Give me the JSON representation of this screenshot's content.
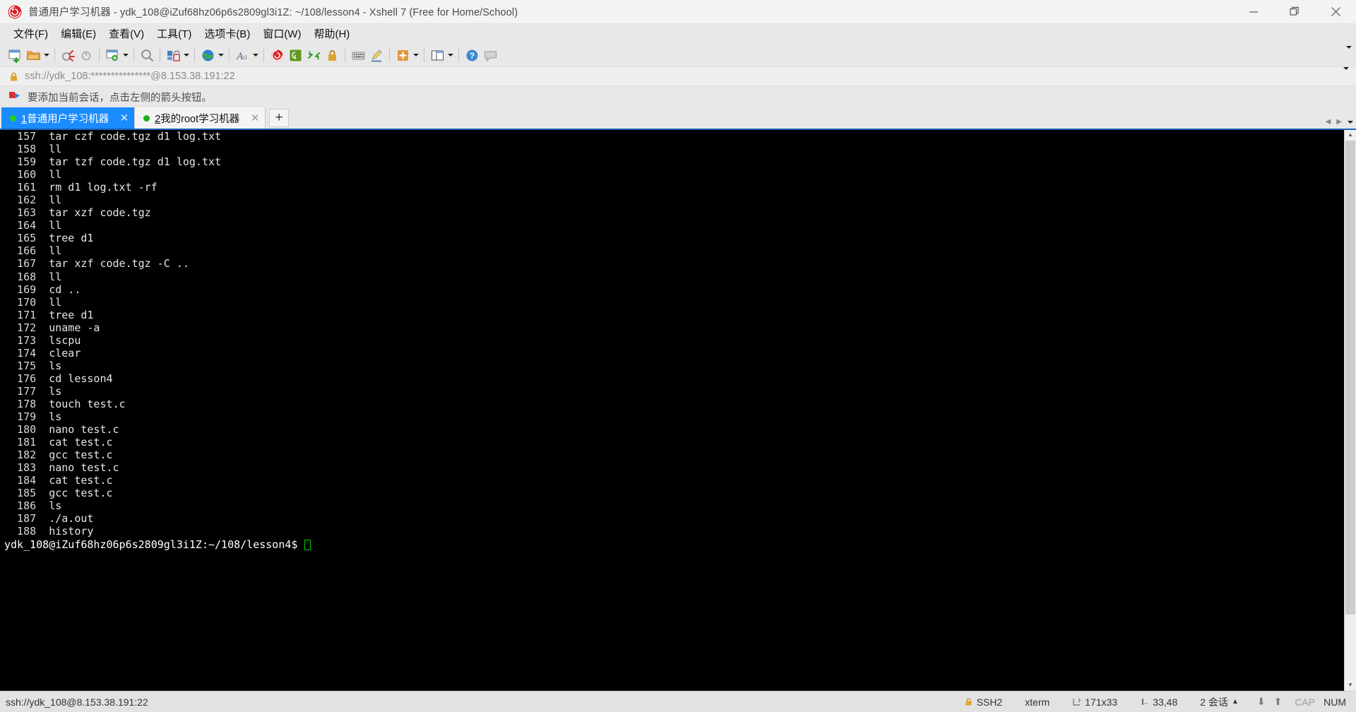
{
  "window": {
    "title": "普通用户学习机器 - ydk_108@iZuf68hz06p6s2809gl3i1Z: ~/108/lesson4 - Xshell 7 (Free for Home/School)",
    "logo_icon": "xshell-spiral-logo",
    "minimize_label": "—",
    "restore_label": "restore-icon",
    "close_label": "✕"
  },
  "menubar": {
    "items": [
      {
        "label": "文件(F)",
        "name": "menu-file"
      },
      {
        "label": "编辑(E)",
        "name": "menu-edit"
      },
      {
        "label": "查看(V)",
        "name": "menu-view"
      },
      {
        "label": "工具(T)",
        "name": "menu-tools"
      },
      {
        "label": "选项卡(B)",
        "name": "menu-tabs"
      },
      {
        "label": "窗口(W)",
        "name": "menu-window"
      },
      {
        "label": "帮助(H)",
        "name": "menu-help"
      }
    ]
  },
  "toolbar": {
    "icons": [
      "new-session-icon",
      "open-folder-icon",
      "open-folder-dropdown-icon",
      "separator",
      "disconnect-icon",
      "reconnect-icon",
      "separator",
      "session-properties-icon",
      "session-properties-dropdown-icon",
      "separator",
      "find-icon",
      "separator",
      "transfer-file-icon",
      "transfer-file-dropdown-icon",
      "separator",
      "globe-icon",
      "globe-dropdown-icon",
      "separator",
      "font-icon",
      "font-dropdown-icon",
      "separator",
      "xshell-icon",
      "xftp-icon",
      "compose-bar-icon",
      "lock-icon",
      "separator",
      "keyboard-icon",
      "highlight-icon",
      "separator",
      "quick-command-icon",
      "quick-command-dropdown-icon",
      "separator",
      "layout-icon",
      "layout-dropdown-icon",
      "separator",
      "help-icon",
      "chat-icon"
    ],
    "overflow_icon": "toolbar-overflow-chevron"
  },
  "address_bar": {
    "lock_icon": "lock-icon",
    "value": "ssh://ydk_108:***************@8.153.38.191:22",
    "placeholder": "ssh://",
    "dropdown_icon": "chevron-down-icon"
  },
  "notification": {
    "icon": "add-session-flag-icon",
    "text": "要添加当前会话，点击左侧的箭头按钮。"
  },
  "tabs": {
    "items": [
      {
        "index": "1",
        "title": "普通用户学习机器",
        "active": true,
        "close_label": "✕",
        "status": "connected"
      },
      {
        "index": "2",
        "title": "我的root学习机器",
        "active": false,
        "close_label": "✕",
        "status": "connected"
      }
    ],
    "new_tab_label": "+",
    "scroll_left_icon": "chevron-left-icon",
    "scroll_right_icon": "chevron-right-icon",
    "list_icon": "chevron-down-icon"
  },
  "terminal": {
    "history": [
      {
        "num": "157",
        "cmd": "tar czf code.tgz d1 log.txt"
      },
      {
        "num": "158",
        "cmd": "ll"
      },
      {
        "num": "159",
        "cmd": "tar tzf code.tgz d1 log.txt"
      },
      {
        "num": "160",
        "cmd": "ll"
      },
      {
        "num": "161",
        "cmd": "rm d1 log.txt -rf"
      },
      {
        "num": "162",
        "cmd": "ll"
      },
      {
        "num": "163",
        "cmd": "tar xzf code.tgz"
      },
      {
        "num": "164",
        "cmd": "ll"
      },
      {
        "num": "165",
        "cmd": "tree d1"
      },
      {
        "num": "166",
        "cmd": "ll"
      },
      {
        "num": "167",
        "cmd": "tar xzf code.tgz -C .."
      },
      {
        "num": "168",
        "cmd": "ll"
      },
      {
        "num": "169",
        "cmd": "cd .."
      },
      {
        "num": "170",
        "cmd": "ll"
      },
      {
        "num": "171",
        "cmd": "tree d1"
      },
      {
        "num": "172",
        "cmd": "uname -a"
      },
      {
        "num": "173",
        "cmd": "lscpu"
      },
      {
        "num": "174",
        "cmd": "clear"
      },
      {
        "num": "175",
        "cmd": "ls"
      },
      {
        "num": "176",
        "cmd": "cd lesson4"
      },
      {
        "num": "177",
        "cmd": "ls"
      },
      {
        "num": "178",
        "cmd": "touch test.c"
      },
      {
        "num": "179",
        "cmd": "ls"
      },
      {
        "num": "180",
        "cmd": "nano test.c"
      },
      {
        "num": "181",
        "cmd": "cat test.c"
      },
      {
        "num": "182",
        "cmd": "gcc test.c"
      },
      {
        "num": "183",
        "cmd": "nano test.c"
      },
      {
        "num": "184",
        "cmd": "cat test.c"
      },
      {
        "num": "185",
        "cmd": "gcc test.c"
      },
      {
        "num": "186",
        "cmd": "ls"
      },
      {
        "num": "187",
        "cmd": "./a.out"
      },
      {
        "num": "188",
        "cmd": "history"
      }
    ],
    "prompt": "ydk_108@iZuf68hz06p6s2809gl3i1Z:~/108/lesson4$ ",
    "cursor": "block-cursor",
    "colors": {
      "background": "#000000",
      "foreground": "#e6e6e6",
      "cursor": "#00d000"
    }
  },
  "statusbar": {
    "connection": "ssh://ydk_108@8.153.38.191:22",
    "lock_icon": "lock-icon",
    "protocol": "SSH2",
    "term_type": "xterm",
    "size_icon": "resize-icon",
    "size": "171x33",
    "cursor_icon": "cursor-pos-icon",
    "cursor_pos": "33,48",
    "sessions": "2 会话",
    "sessions_caret": "▲",
    "upload_icon": "arrow-up-icon",
    "download_icon": "arrow-down-icon",
    "caps": "CAP",
    "num": "NUM"
  }
}
